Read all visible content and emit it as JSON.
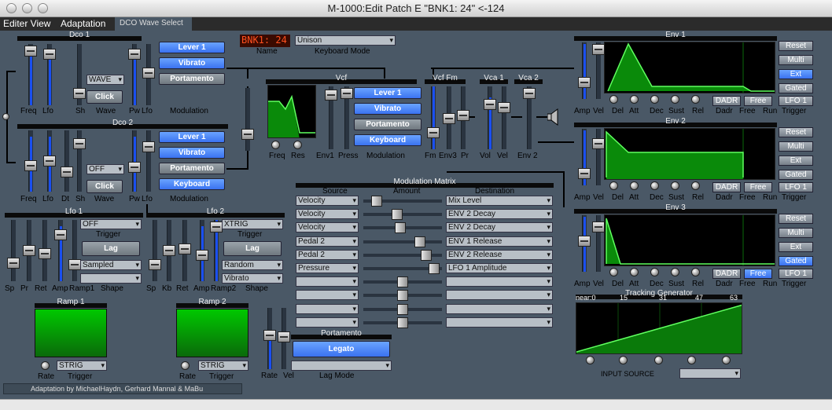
{
  "window": {
    "title": "M-1000:Edit Patch E \"BNK1: 24\" <-124"
  },
  "menu": {
    "editor_view": "Editer View",
    "adaptation": "Adaptation",
    "dco_wave_select": "DCO Wave Select"
  },
  "dco1": {
    "title": "Dco 1",
    "wave": "WAVE",
    "click": "Click",
    "labels": [
      "Freq",
      "Lfo",
      "Sh",
      "Wave",
      "Pw",
      "Lfo"
    ],
    "modulation": "Modulation"
  },
  "dco2": {
    "title": "Dco 2",
    "wave": "OFF",
    "click": "Click",
    "labels": [
      "Freq",
      "Lfo",
      "Dt",
      "Sh",
      "Wave",
      "Pw",
      "Lfo"
    ],
    "modulation": "Modulation"
  },
  "buttons": {
    "lever1": "Lever 1",
    "vibrato": "Vibrato",
    "portamento": "Portamento",
    "keyboard": "Keyboard",
    "legato": "Legato"
  },
  "patch": {
    "name": "BNK1: 24",
    "name_label": "Name",
    "mode": "Unison",
    "mode_label": "Keyboard Mode"
  },
  "vcf": {
    "title": "Vcf",
    "fm_title": "Vcf Fm",
    "labels": [
      "Freq",
      "Res",
      "Env1",
      "Press",
      "Modulation",
      "Fm",
      "Env3",
      "Pr"
    ]
  },
  "vca": {
    "title1": "Vca 1",
    "title2": "Vca 2",
    "labels": [
      "Vol",
      "Vel",
      "Env 2"
    ]
  },
  "lfo1": {
    "title": "Lfo 1",
    "trigger": "OFF",
    "trigger_label": "Trigger",
    "lag": "Lag",
    "shape": "Sampled",
    "shape_label": "Shape",
    "labels": [
      "Sp",
      "Pr",
      "Ret",
      "Amp",
      "Ramp1"
    ]
  },
  "lfo2": {
    "title": "Lfo 2",
    "trigger": "XTRIG",
    "trigger_label": "Trigger",
    "lag": "Lag",
    "shape": "Random",
    "shape2": "Vibrato",
    "shape_label": "Shape",
    "labels": [
      "Sp",
      "Kb",
      "Ret",
      "Amp",
      "Ramp2"
    ]
  },
  "ramp1": {
    "title": "Ramp 1",
    "trigger": "STRIG",
    "rate": "Rate",
    "trigger_label": "Trigger"
  },
  "ramp2": {
    "title": "Ramp 2",
    "trigger": "STRIG",
    "rate": "Rate",
    "trigger_label": "Trigger"
  },
  "portamento": {
    "title": "Portamento",
    "rate": "Rate",
    "vel": "Vel",
    "lag_mode": "Lag Mode"
  },
  "matrix": {
    "title": "Modulation Matrix",
    "source": "Source",
    "amount": "Amount",
    "destination": "Destination",
    "rows": [
      {
        "src": "Velocity",
        "dst": "Mix Level",
        "amt": 0.12
      },
      {
        "src": "Velocity",
        "dst": "ENV 2 Decay",
        "amt": 0.42
      },
      {
        "src": "Velocity",
        "dst": "ENV 2 Decay",
        "amt": 0.47
      },
      {
        "src": "Pedal 2",
        "dst": "ENV 1 Release",
        "amt": 0.75
      },
      {
        "src": "Pedal 2",
        "dst": "ENV 2 Release",
        "amt": 0.85
      },
      {
        "src": "Pressure",
        "dst": "LFO 1 Amplitude",
        "amt": 0.97
      },
      {
        "src": "",
        "dst": "",
        "amt": 0.5
      },
      {
        "src": "",
        "dst": "",
        "amt": 0.5
      },
      {
        "src": "",
        "dst": "",
        "amt": 0.5
      },
      {
        "src": "",
        "dst": "",
        "amt": 0.5
      }
    ]
  },
  "env1": {
    "title": "Env 1",
    "side": [
      "Reset",
      "Multi",
      "Ext",
      "Gated"
    ],
    "side_on": 2,
    "mode": "DADR",
    "free": "Free",
    "lfo": "LFO 1",
    "labels": [
      "Amp",
      "Vel",
      "Del",
      "Att",
      "Dec",
      "Sust",
      "Rel",
      "Dadr",
      "Free",
      "Run",
      "Trigger"
    ]
  },
  "env2": {
    "title": "Env 2",
    "side": [
      "Reset",
      "Multi",
      "Ext",
      "Gated"
    ],
    "side_on": -1,
    "mode": "DADR",
    "free": "Free",
    "lfo": "LFO 1",
    "labels": [
      "Amp",
      "Vel",
      "Del",
      "Att",
      "Dec",
      "Sust",
      "Rel",
      "Dadr",
      "Free",
      "Run",
      "Trigger"
    ]
  },
  "env3": {
    "title": "Env 3",
    "side": [
      "Reset",
      "Multi",
      "Ext",
      "Gated"
    ],
    "side_on": 3,
    "mode": "DADR",
    "free": "Free",
    "lfo": "LFO 1",
    "labels": [
      "Amp",
      "Vel",
      "Del",
      "Att",
      "Dec",
      "Sust",
      "Rel",
      "Dadr",
      "Free",
      "Run",
      "Trigger"
    ]
  },
  "tracking": {
    "title": "Tracking Generator",
    "scale": [
      "near:0",
      "15",
      "31",
      "47",
      "63"
    ],
    "input_source": "INPUT SOURCE"
  },
  "footer": {
    "credits": "Adaptation by MichaelHaydn, Gerhard Mannal & MaBu"
  }
}
